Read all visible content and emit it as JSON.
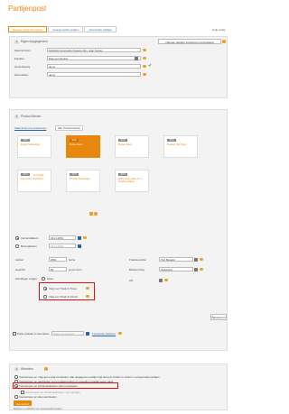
{
  "page": {
    "title": "Partijenpost"
  },
  "tabs": [
    {
      "label": "Nieuwe partij aanmaken"
    },
    {
      "label": "Voorgemelde partijen"
    },
    {
      "label": "Verzonden partijen"
    }
  ],
  "help_label": "Hulp nodig",
  "step1": {
    "number": "1",
    "title": "Eigen kopgegevens",
    "import_button": "Nieuwe partijen importeren uit bestand",
    "fields": [
      {
        "label": "Klantnummer",
        "value": "1022302 Commodity Poweria, Bm. Jean Tonsen"
      },
      {
        "label": "Facuiter",
        "value": "Date een facuiter"
      },
      {
        "label": "Omschrijving",
        "value": "demo"
      },
      {
        "label": "Kenmerken",
        "value": "demo"
      }
    ]
  },
  "step2": {
    "number": "2",
    "title": "Product kiezen",
    "subtabs": [
      {
        "label": "Vaak al bij ons produceren"
      },
      {
        "label": "Alle Postproducten"
      }
    ],
    "tiles": [
      {
        "badge": "1005",
        "label": "Enkel Sparkstijgt",
        "extra": ""
      },
      {
        "badge": "1020",
        "label": "Grote Stam",
        "extra": "",
        "selected": true
      },
      {
        "badge": "1050",
        "label": "Buiten Stam",
        "extra": ""
      },
      {
        "badge": "1061",
        "label": "Busiest Old Stam",
        "extra": ""
      },
      {
        "badge": "1074",
        "label": "Economic Old Stam",
        "extra": "Overheid"
      },
      {
        "badge": "1075",
        "label": "Priority Sparkstijgt",
        "extra": ""
      },
      {
        "badge": "1079",
        "label": "EMS Verzenden (2 m zending/stam)",
        "extra": ""
      }
    ],
    "send_options": [
      {
        "label": "Verzenddatum",
        "value": "23-11-2016"
      },
      {
        "label": "Bezorgdatum",
        "value": "23-11-2016"
      }
    ],
    "left_fields": [
      {
        "label": "Aantal",
        "value": "2500",
        "unit": "items"
      },
      {
        "label": "Gewicht",
        "value": "50",
        "unit": "gr per item"
      }
    ],
    "zending_label": "Zendingen volgen:",
    "zending_none": "Geen",
    "zending_options": [
      {
        "label": "Volg met Track & Trace"
      },
      {
        "label": "Volg met Track & Check"
      }
    ],
    "right_fields": [
      {
        "label": "Frankeerwijze",
        "value": "Port Betaald"
      },
      {
        "label": "Bestemming",
        "value": "Nederland"
      },
      {
        "label": "HS",
        "value": ""
      }
    ],
    "calc_button": "Berekenen",
    "extra_option": "Partij opslaan in favorieten",
    "favorites_placeholder": "Naam van favoriet",
    "favorites_link": "Favorieten beheren"
  },
  "step3": {
    "number": "3",
    "title": "Afronden",
    "options": [
      "Voorwerpen en mag aan partij voorleiden, alle opgegeven partijen tijd terug te vinden in scherm voorgemelde partijen",
      "Voorwerpen en aanbieden voor postbezorging zo spoedig mogelijk neem partij",
      "Voorwerpen en achteraanbieden direct uploaden",
      "Voorwerpen en achteraanbieden voor partijen",
      "Voorwerpen en later aanbieden"
    ],
    "submit_button": "Ga verder",
    "footer_text": "Bekijken en afsluiten van voorgemelde partijen"
  },
  "colors": {
    "accent": "#e8870e",
    "highlight": "#e01010",
    "link": "#2a64a8"
  }
}
